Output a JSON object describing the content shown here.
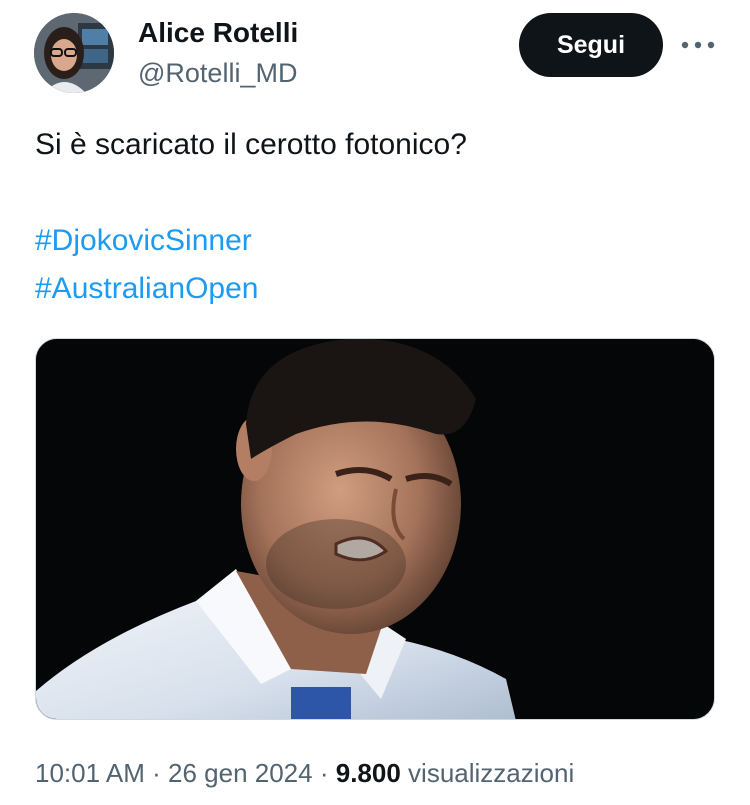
{
  "author": {
    "name": "Alice Rotelli",
    "handle": "@Rotelli_MD"
  },
  "actions": {
    "follow_label": "Segui",
    "more_icon": "ellipsis-icon"
  },
  "tweet": {
    "text": "Si è scaricato il cerotto fotonico?",
    "hashtags": [
      "#DjokovicSinner",
      "#AustralianOpen"
    ]
  },
  "footer": {
    "time": "10:01 AM",
    "separator": "·",
    "date": "26 gen 2024",
    "views_count": "9.800",
    "views_label": "visualizzazioni"
  },
  "colors": {
    "link": "#1d9bf0",
    "secondary_text": "#536471",
    "primary_text": "#0f1419",
    "follow_button_bg": "#0f1419"
  }
}
